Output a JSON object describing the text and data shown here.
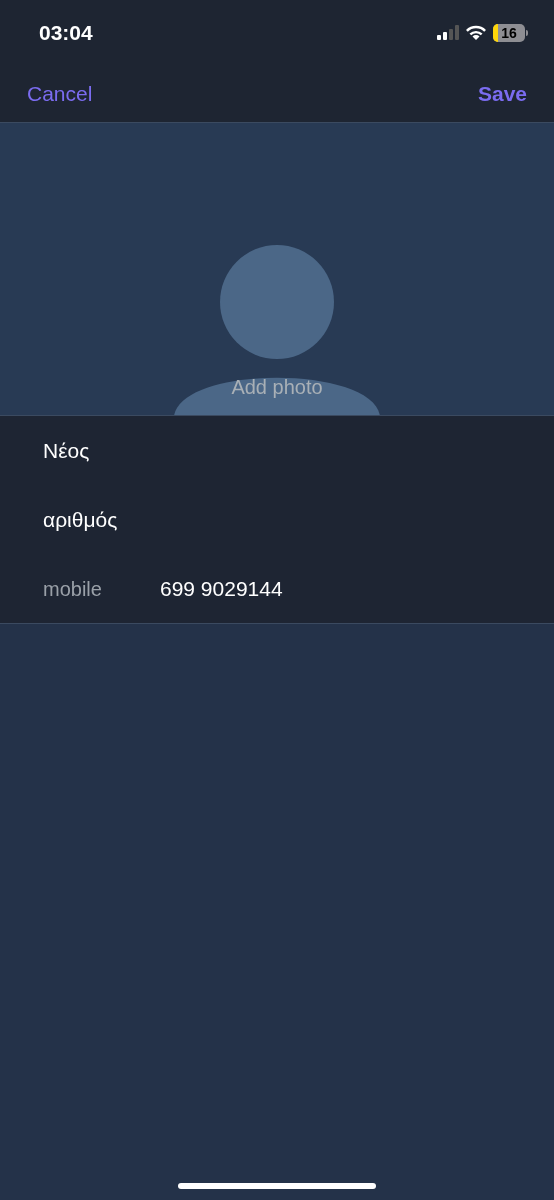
{
  "status_bar": {
    "time": "03:04",
    "battery": "16"
  },
  "nav": {
    "cancel": "Cancel",
    "save": "Save"
  },
  "photo": {
    "label": "Add photo"
  },
  "fields": [
    {
      "kind": "text",
      "value": "Νέος"
    },
    {
      "kind": "text",
      "value": "αριθμός"
    },
    {
      "kind": "phone",
      "label": "mobile",
      "value": "699 9029144"
    }
  ]
}
